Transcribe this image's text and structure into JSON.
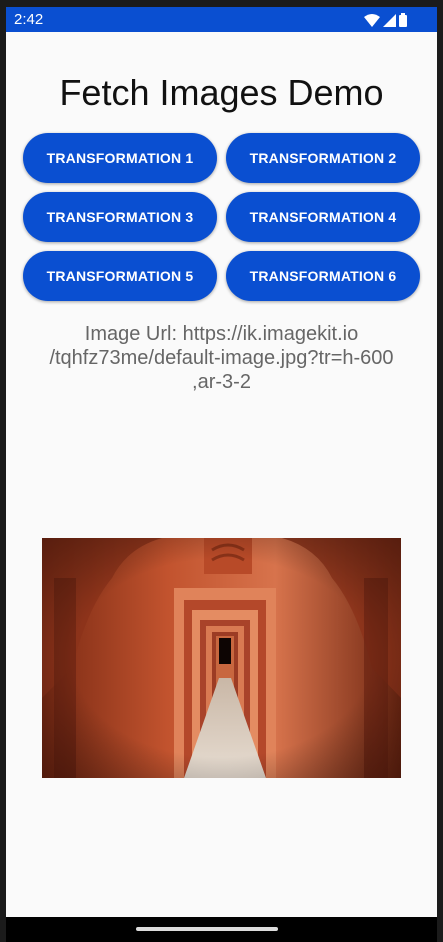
{
  "status_bar": {
    "time": "2:42",
    "icons": [
      "wifi-icon",
      "cell-signal-icon",
      "battery-icon"
    ]
  },
  "app": {
    "title": "Fetch Images Demo"
  },
  "buttons": [
    "TRANSFORMATION 1",
    "TRANSFORMATION 2",
    "TRANSFORMATION 3",
    "TRANSFORMATION 4",
    "TRANSFORMATION 5",
    "TRANSFORMATION 6"
  ],
  "image_url": {
    "line1": "Image Url: https://ik.imagekit.io",
    "line2": "/tqhfz73me/default-image.jpg?tr=h-600",
    "line3": ",ar-3-2"
  },
  "colors": {
    "accent": "#0a4fd1",
    "background": "#fafafa",
    "url_text": "#666666"
  }
}
